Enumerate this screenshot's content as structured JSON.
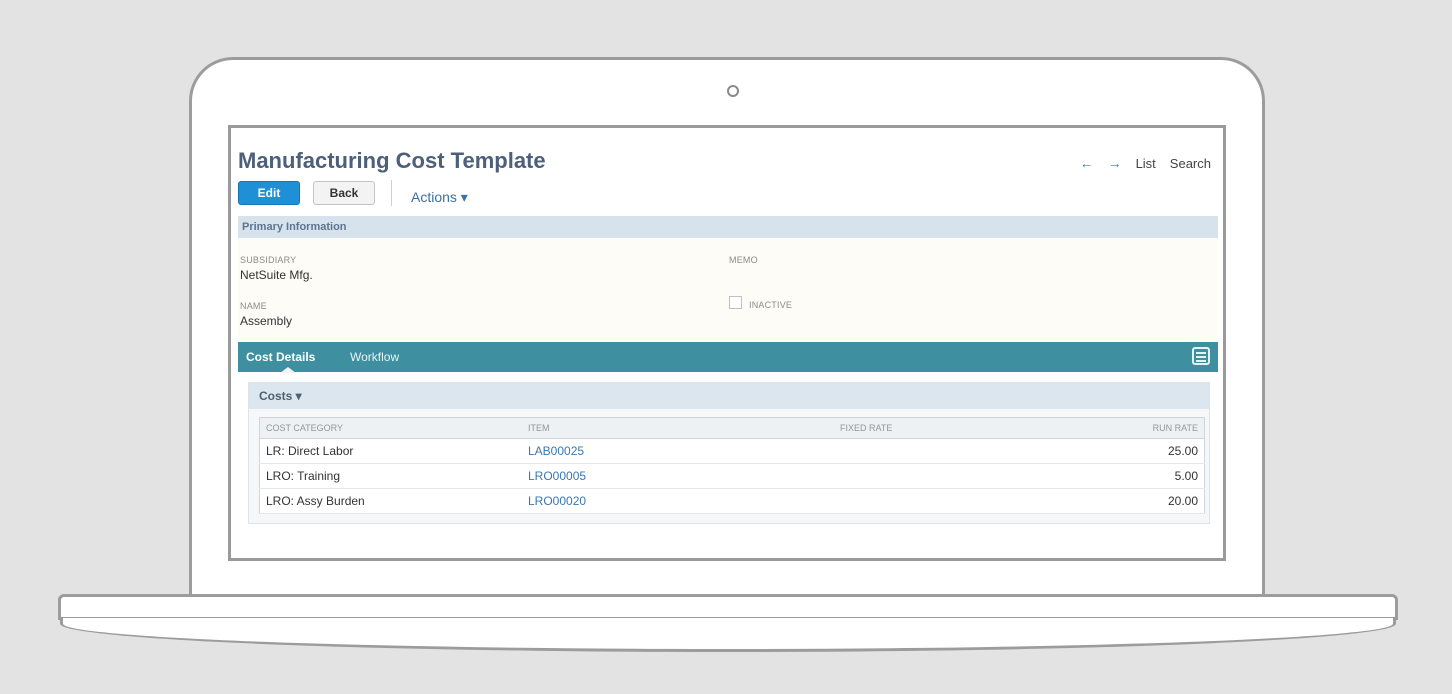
{
  "header": {
    "title": "Manufacturing Cost Template",
    "nav_back": "←",
    "nav_forward": "→",
    "list_label": "List",
    "search_label": "Search"
  },
  "toolbar": {
    "edit_label": "Edit",
    "back_label": "Back",
    "actions_label": "Actions ▾"
  },
  "primary": {
    "section_title": "Primary Information",
    "subsidiary_label": "SUBSIDIARY",
    "subsidiary_value": "NetSuite Mfg.",
    "name_label": "NAME",
    "name_value": "Assembly",
    "memo_label": "MEMO",
    "inactive_label": "INACTIVE",
    "inactive_checked": false
  },
  "tabs": [
    {
      "label": "Cost Details",
      "active": true
    },
    {
      "label": "Workflow",
      "active": false
    }
  ],
  "costs": {
    "title": "Costs ▾",
    "columns": [
      "COST CATEGORY",
      "ITEM",
      "FIXED RATE",
      "RUN RATE"
    ],
    "rows": [
      {
        "category": "LR: Direct Labor",
        "item": "LAB00025",
        "fixed_rate": "",
        "run_rate": "25.00"
      },
      {
        "category": "LRO: Training",
        "item": "LRO00005",
        "fixed_rate": "",
        "run_rate": "5.00"
      },
      {
        "category": "LRO: Assy Burden",
        "item": "LRO00020",
        "fixed_rate": "",
        "run_rate": "20.00"
      }
    ]
  },
  "colors": {
    "title": "#4d5f79",
    "primary_button": "#1f8fd6",
    "tab_bar": "#3e8f9f",
    "link": "#3a78b0"
  }
}
